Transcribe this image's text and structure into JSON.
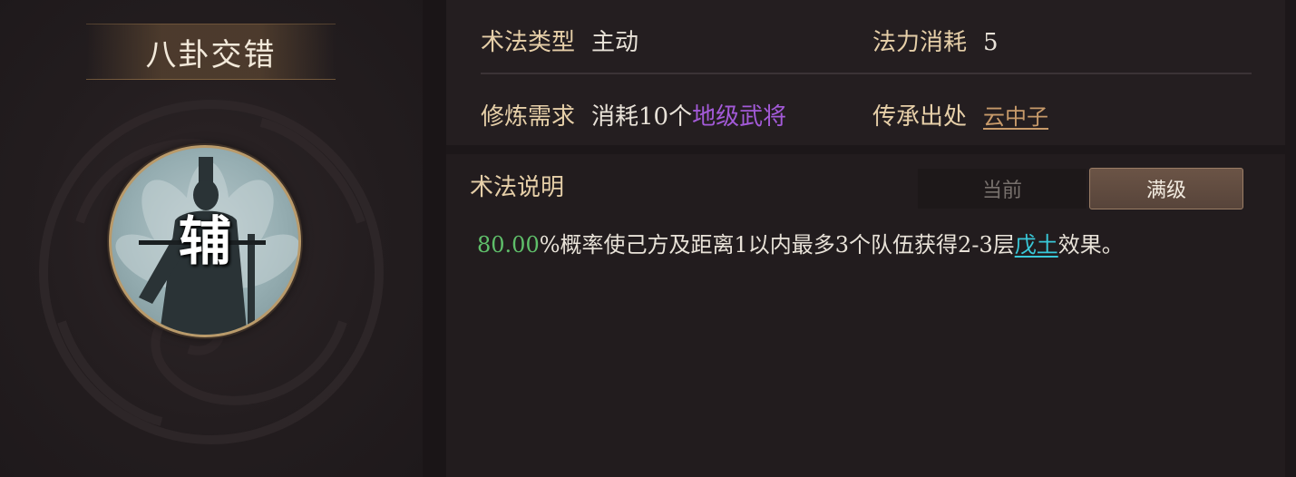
{
  "skill": {
    "name": "八卦交错",
    "role_char": "辅"
  },
  "info": {
    "type_label": "术法类型",
    "type_value": "主动",
    "mana_label": "法力消耗",
    "mana_value": "5",
    "train_label": "修炼需求",
    "train_value_prefix": "消耗10个",
    "train_value_highlight": "地级武将",
    "origin_label": "传承出处",
    "origin_value": "云中子"
  },
  "description": {
    "title": "术法说明",
    "tab_current": "当前",
    "tab_max": "满级",
    "percent": "80.00",
    "text_before": "%概率使己方及距离1以内最多3个队伍获得2-3层",
    "effect_link": "戊土",
    "text_after": "效果。"
  },
  "colors": {
    "label": "#e6cfa8",
    "highlight_purple": "#a35ad8",
    "percent_green": "#5fbf6a",
    "effect_cyan": "#39c8d8",
    "origin_link": "#c79a6a"
  }
}
